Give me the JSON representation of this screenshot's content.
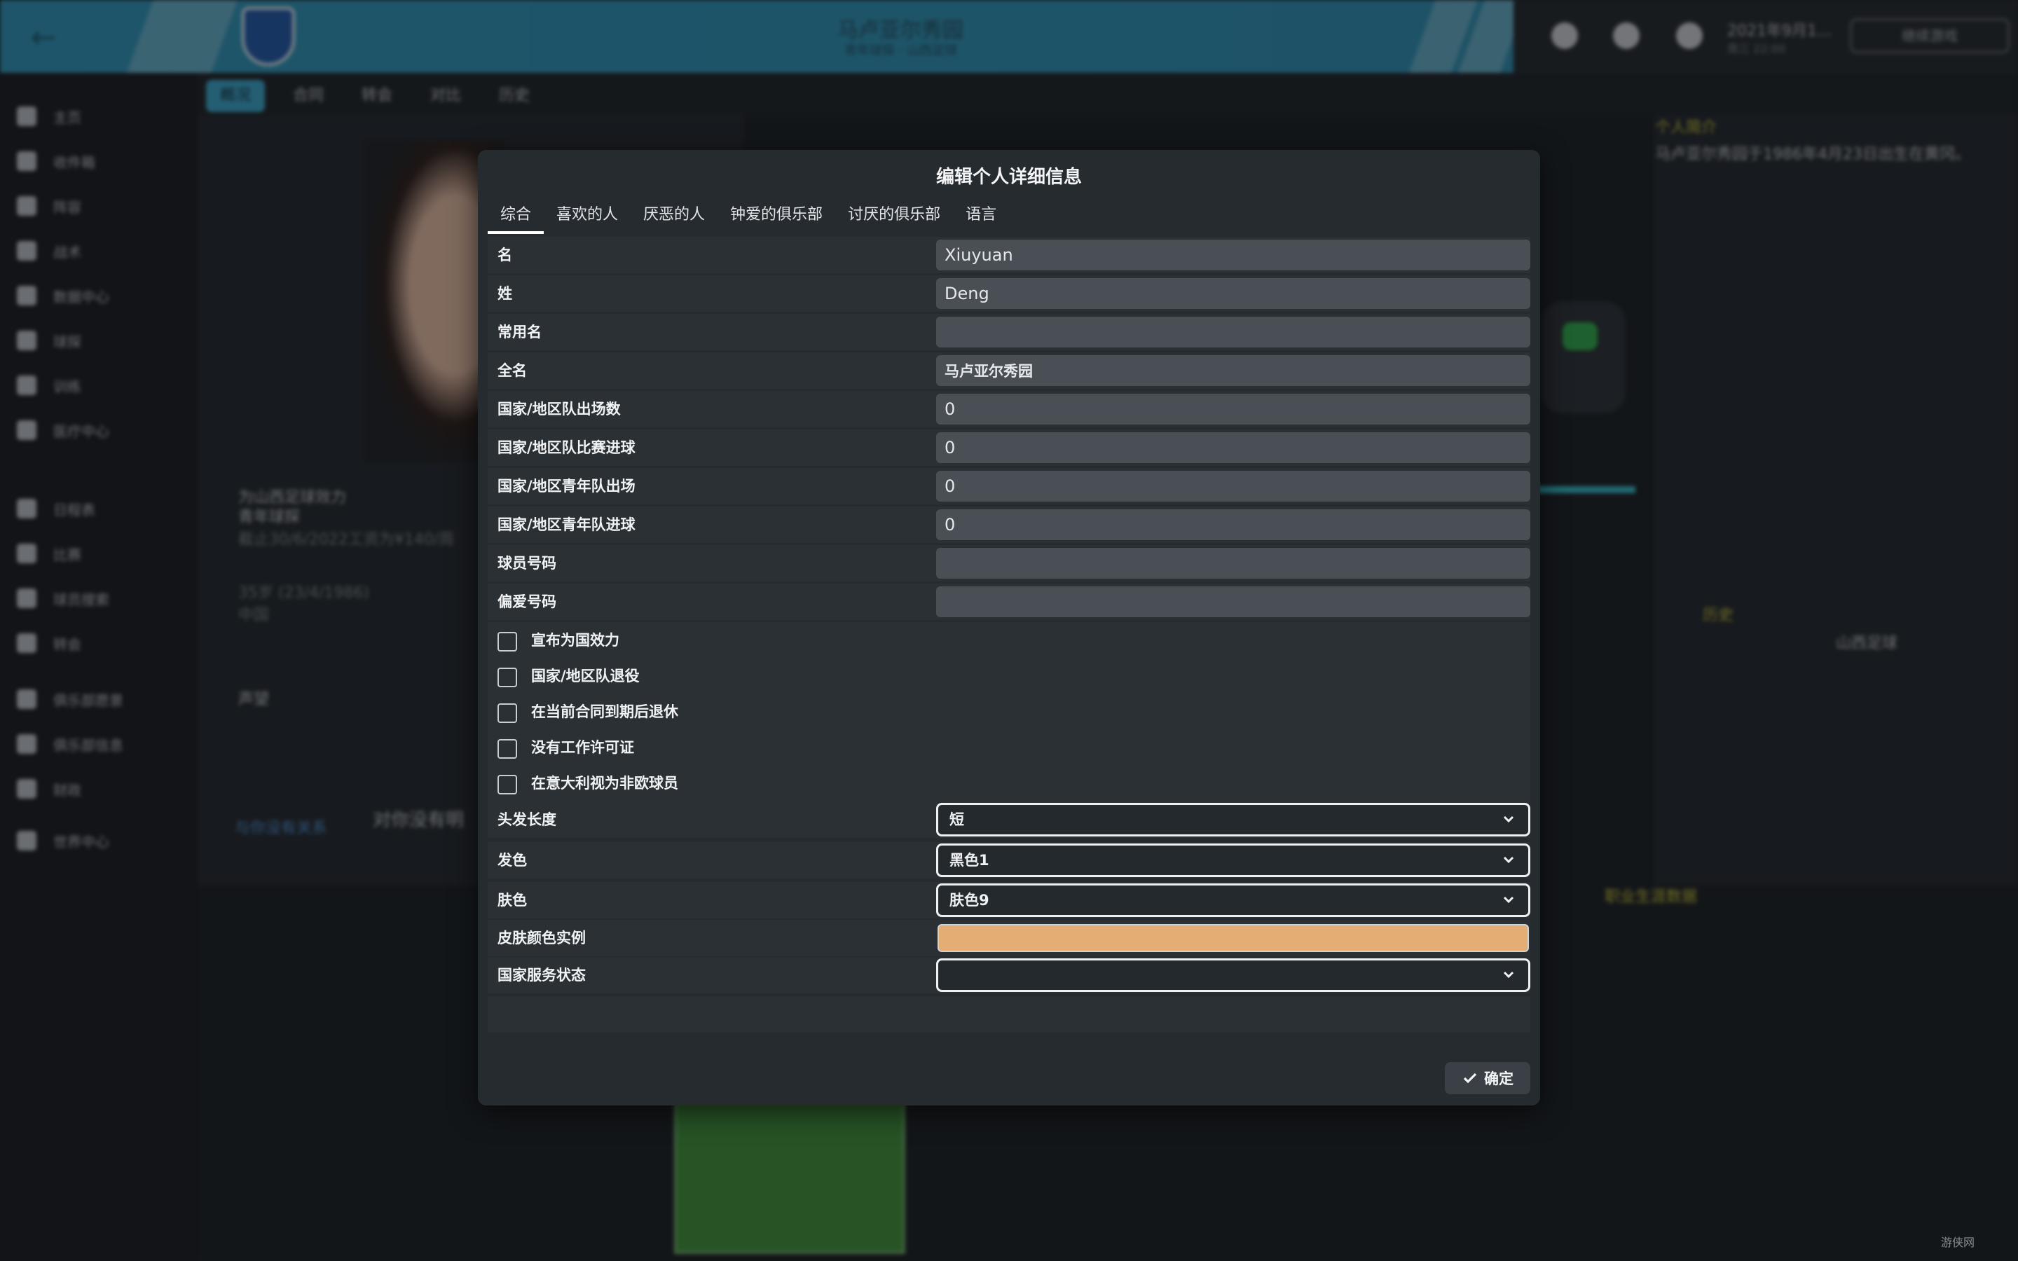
{
  "background": {
    "page_title": "马卢亚尔秀园",
    "page_subtitle": "青年球探 · 山西足球",
    "date": "2021年9月1...",
    "date_sub": "周三 22:00",
    "continue_button": "继续游戏",
    "sidebar": [
      "主页",
      "收件箱",
      "阵容",
      "战术",
      "数据中心",
      "球探",
      "训练",
      "医疗中心",
      "日程表",
      "比赛",
      "球员搜索",
      "转会",
      "俱乐部愿景",
      "俱乐部信息",
      "财政",
      "世界中心"
    ],
    "subnav": [
      "概况",
      "合同",
      "转会",
      "对比",
      "历史"
    ],
    "info_texts": {
      "tag1": "为山西足球效力",
      "tag2": "青年球探",
      "contract": "截止30/6/2022工资为¥140/周",
      "age": "35岁 (23/4/1986)",
      "nation": "中国",
      "rep_label": "声望",
      "relations": "与你没有关系",
      "relations_sub": "对你没有明",
      "bio_title": "个人简介",
      "bio": "马卢亚尔秀园于1986年4月23日出生在黄冈。",
      "history_label": "历史",
      "history_club": "山西足球",
      "career_label": "职业生涯数据"
    }
  },
  "modal": {
    "title": "编辑个人详细信息",
    "tabs": [
      "综合",
      "喜欢的人",
      "厌恶的人",
      "钟爱的俱乐部",
      "讨厌的俱乐部",
      "语言"
    ],
    "fields": {
      "first_name": {
        "label": "名",
        "value": "Xiuyuan"
      },
      "last_name": {
        "label": "姓",
        "value": "Deng"
      },
      "common_name": {
        "label": "常用名",
        "value": ""
      },
      "full_name": {
        "label": "全名",
        "value": "马卢亚尔秀园"
      },
      "intl_caps": {
        "label": "国家/地区队出场数",
        "value": "0"
      },
      "intl_goals": {
        "label": "国家/地区队比赛进球",
        "value": "0"
      },
      "youth_caps": {
        "label": "国家/地区青年队出场",
        "value": "0"
      },
      "youth_goals": {
        "label": "国家/地区青年队进球",
        "value": "0"
      },
      "squad_number": {
        "label": "球员号码",
        "value": ""
      },
      "preferred_number": {
        "label": "偏爱号码",
        "value": ""
      }
    },
    "checkboxes": {
      "declared": "宣布为国效力",
      "retired_intl": "国家/地区队退役",
      "retire_end": "在当前合同到期后退休",
      "no_permit": "没有工作许可证",
      "non_eu_italy": "在意大利视为非欧球员"
    },
    "selects": {
      "hair_length": {
        "label": "头发长度",
        "value": "短"
      },
      "hair_color": {
        "label": "发色",
        "value": "黑色1"
      },
      "skin_tone": {
        "label": "肤色",
        "value": "肤色9"
      },
      "national_service": {
        "label": "国家服务状态",
        "value": ""
      }
    },
    "skin_example": {
      "label": "皮肤颜色实例",
      "color": "#e3ad74"
    },
    "confirm_label": "确定"
  },
  "watermark": "游侠网"
}
